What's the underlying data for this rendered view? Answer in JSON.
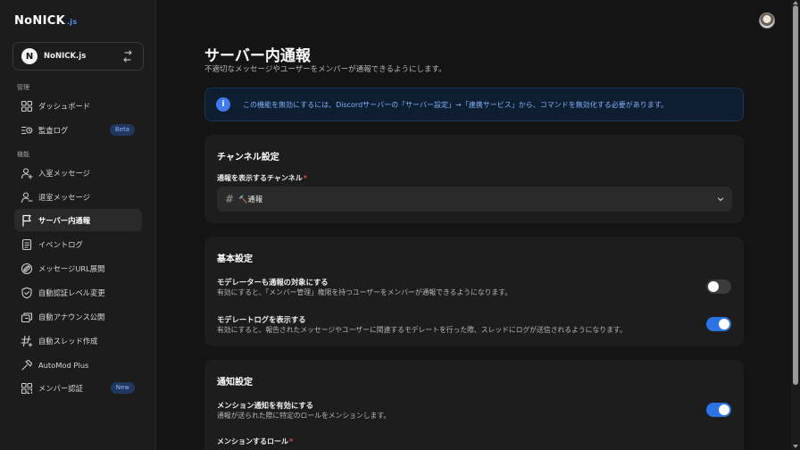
{
  "app": {
    "logo_main": "NoNICK",
    "logo_suffix": ".js"
  },
  "guild": {
    "avatar_letter": "N",
    "name": "NoNICK.js"
  },
  "sidebar": {
    "sections": [
      {
        "label": "管理"
      },
      {
        "label": "機能"
      }
    ],
    "items": [
      {
        "label": "ダッシュボード",
        "icon": "dashboard-icon"
      },
      {
        "label": "監査ログ",
        "icon": "audit-log-icon",
        "badge": "Beta"
      },
      {
        "label": "入室メッセージ",
        "icon": "user-join-icon"
      },
      {
        "label": "退室メッセージ",
        "icon": "user-leave-icon"
      },
      {
        "label": "サーバー内通報",
        "icon": "flag-icon",
        "active": true
      },
      {
        "label": "イベントログ",
        "icon": "event-log-icon"
      },
      {
        "label": "メッセージURL展開",
        "icon": "message-link-icon"
      },
      {
        "label": "自動認証レベル変更",
        "icon": "shield-icon"
      },
      {
        "label": "自動アナウンス公開",
        "icon": "megaphone-icon"
      },
      {
        "label": "自動スレッド作成",
        "icon": "thread-icon"
      },
      {
        "label": "AutoMod Plus",
        "icon": "automod-icon"
      },
      {
        "label": "メンバー認証",
        "icon": "member-verify-icon",
        "badge": "New"
      }
    ]
  },
  "page": {
    "title": "サーバー内通報",
    "description": "不適切なメッセージやユーザーをメンバーが通報できるようにします。"
  },
  "alert": {
    "text": "この機能を無効にするには、Discordサーバーの「サーバー設定」→「連携サービス」から、コマンドを無効化する必要があります。"
  },
  "channel_settings": {
    "title": "チャンネル設定",
    "field_label": "通報を表示するチャンネル",
    "required_mark": "*",
    "hash": "#",
    "selected_value": "🔨通報"
  },
  "basic_settings": {
    "title": "基本設定",
    "rows": [
      {
        "title": "モデレーターも通報の対象にする",
        "description": "有効にすると、「メンバー管理」権限を持つユーザーをメンバーが通報できるようになります。",
        "enabled": false
      },
      {
        "title": "モデレートログを表示する",
        "description": "有効にすると、報告されたメッセージやユーザーに関連するモデレートを行った際、スレッドにログが送信されるようになります。",
        "enabled": true
      }
    ]
  },
  "notification_settings": {
    "title": "通知設定",
    "rows": [
      {
        "title": "メンション通知を有効にする",
        "description": "通報が送られた際に特定のロールをメンションします。",
        "enabled": true
      }
    ],
    "role_field_label": "メンションするロール",
    "required_mark": "*"
  },
  "colors": {
    "accent": "#2b74e8",
    "alert_text": "#7fb2ff",
    "required": "#e5484d"
  }
}
